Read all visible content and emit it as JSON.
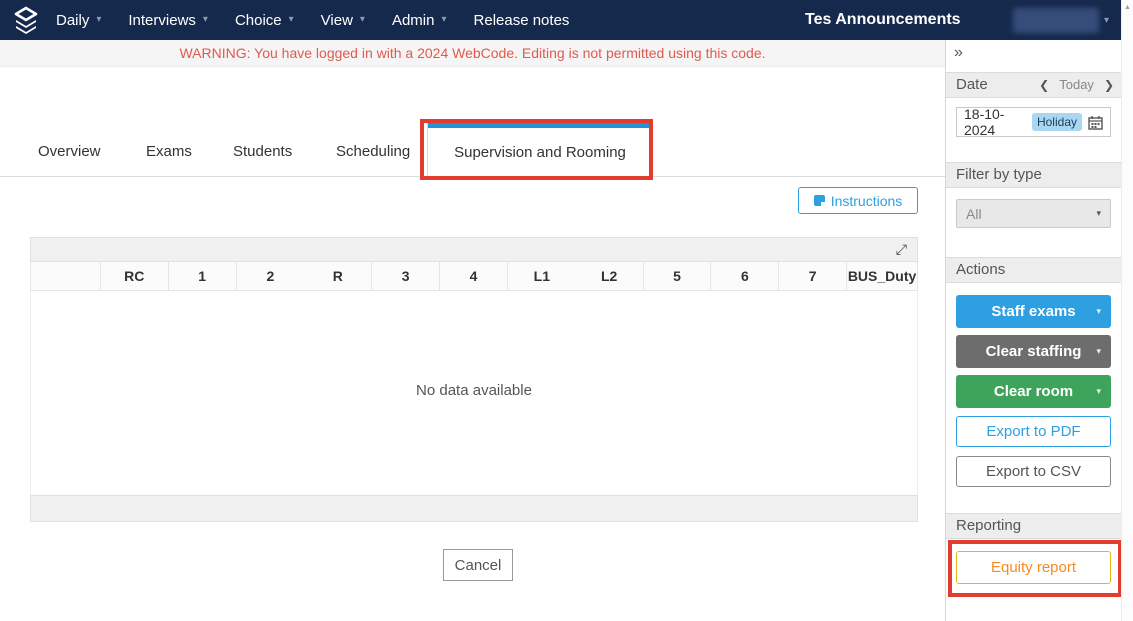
{
  "navbar": {
    "menus": [
      {
        "label": "Daily",
        "caret": true
      },
      {
        "label": "Interviews",
        "caret": true
      },
      {
        "label": "Choice",
        "caret": true
      },
      {
        "label": "View",
        "caret": true
      },
      {
        "label": "Admin",
        "caret": true
      },
      {
        "label": "Release notes",
        "caret": false
      }
    ],
    "announcements": "Tes Announcements",
    "background_color": "#15294d"
  },
  "warning": {
    "text": "WARNING: You have logged in with a 2024 WebCode. Editing is not permitted using this code.",
    "text_color": "#e05a4e"
  },
  "tabs": {
    "items": [
      {
        "label": "Overview",
        "active": false
      },
      {
        "label": "Exams",
        "active": false
      },
      {
        "label": "Students",
        "active": false
      },
      {
        "label": "Scheduling",
        "active": false
      },
      {
        "label": "Supervision and Rooming",
        "active": true
      }
    ],
    "active_indicator_color": "#2793d5",
    "annotation_color": "#e23b2f"
  },
  "toolbar": {
    "instructions_label": "Instructions"
  },
  "table": {
    "columns": [
      "",
      "RC",
      "1",
      "2",
      "R",
      "3",
      "4",
      "L1",
      "L2",
      "5",
      "6",
      "7",
      "BUS_Duty"
    ],
    "empty_message": "No data available"
  },
  "footer": {
    "cancel_label": "Cancel"
  },
  "sidebar": {
    "date": {
      "title": "Date",
      "today_label": "Today",
      "value": "18-10-2024",
      "badge": "Holiday",
      "badge_color": "#a9d6f0"
    },
    "filter": {
      "title": "Filter by type",
      "selected": "All"
    },
    "actions": {
      "title": "Actions",
      "staff_exams": "Staff exams",
      "clear_staffing": "Clear staffing",
      "clear_room": "Clear room",
      "export_pdf": "Export to PDF",
      "export_csv": "Export to CSV",
      "staff_exams_color": "#2e9fe0",
      "clear_staffing_color": "#6d6d6d",
      "clear_room_color": "#3fa45b"
    },
    "reporting": {
      "title": "Reporting",
      "equity_report": "Equity report",
      "equity_border_color": "#eab513",
      "equity_text_color": "#f68b1f"
    }
  },
  "icons": {
    "caret": "▾",
    "chevron_left": "❮",
    "chevron_right": "❯",
    "double_chevron_right": "»",
    "expand": "⤢",
    "scroll_up": "▲"
  }
}
